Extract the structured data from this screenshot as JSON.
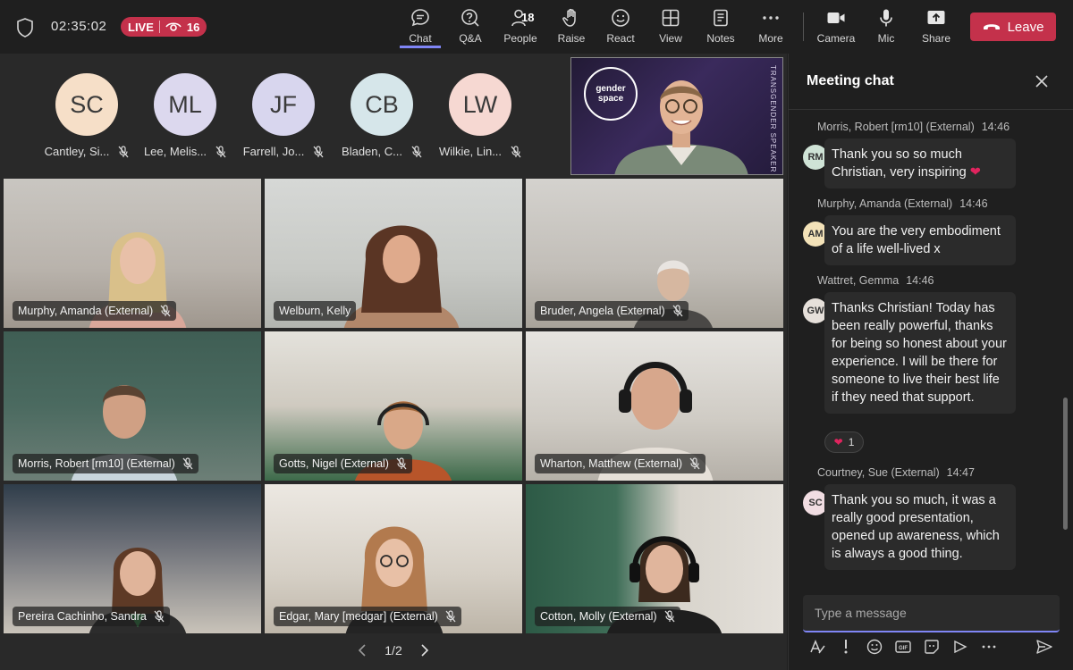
{
  "topbar": {
    "timer": "02:35:02",
    "live_label": "LIVE",
    "viewer_count": "16",
    "buttons": {
      "chat": "Chat",
      "qa": "Q&A",
      "people": "People",
      "people_count": "18",
      "raise": "Raise",
      "react": "React",
      "view": "View",
      "notes": "Notes",
      "more": "More",
      "camera": "Camera",
      "mic": "Mic",
      "share": "Share",
      "leave": "Leave"
    },
    "accent": "#7f85f5",
    "leave_color": "#c4314b"
  },
  "avatars": [
    {
      "initials": "SC",
      "name": "Cantley, Si...",
      "color": "#f6dfc8"
    },
    {
      "initials": "ML",
      "name": "Lee, Melis...",
      "color": "#dcd8ee"
    },
    {
      "initials": "JF",
      "name": "Farrell, Jo...",
      "color": "#d8d6ee"
    },
    {
      "initials": "CB",
      "name": "Bladen, C...",
      "color": "#d6e6ea"
    },
    {
      "initials": "LW",
      "name": "Wilkie, Lin...",
      "color": "#f6d8d2"
    }
  ],
  "speaker": {
    "logo_line1": "gender",
    "logo_line2": "space",
    "side_text": "TRANSGENDER SPEAKER"
  },
  "tiles": [
    {
      "name": "Murphy, Amanda (External)"
    },
    {
      "name": "Welburn, Kelly"
    },
    {
      "name": "Bruder, Angela (External)"
    },
    {
      "name": "Morris, Robert [rm10] (External)"
    },
    {
      "name": "Gotts, Nigel (External)"
    },
    {
      "name": "Wharton, Matthew (External)"
    },
    {
      "name": "Pereira Cachinho, Sandra"
    },
    {
      "name": "Edgar, Mary [medgar] (External)"
    },
    {
      "name": "Cotton, Molly (External)"
    }
  ],
  "pager": {
    "label": "1/2"
  },
  "chat": {
    "title": "Meeting chat",
    "messages": [
      {
        "author": "Morris, Robert [rm10] (External)",
        "time": "14:46",
        "initials": "RM",
        "color": "#cfe3d6",
        "text": "Thank you so so much Christian, very inspiring"
      },
      {
        "author": "Murphy, Amanda (External)",
        "time": "14:46",
        "initials": "AM",
        "color": "#f3e2b8",
        "text": "You are the very embodiment of a life well-lived x"
      },
      {
        "author": "Wattret, Gemma",
        "time": "14:46",
        "initials": "GW",
        "color": "#e6e0da",
        "text": "Thanks Christian! Today has been really powerful, thanks for being so honest about your experience.  I will be there for someone to live their best life if they need that support.",
        "reaction_count": "1"
      },
      {
        "author": "Courtney, Sue (External)",
        "time": "14:47",
        "initials": "SC",
        "color": "#f1dde2",
        "text": "Thank you so much, it was a really good presentation, opened up awareness, which is always a good thing."
      }
    ],
    "placeholder": "Type a message"
  }
}
